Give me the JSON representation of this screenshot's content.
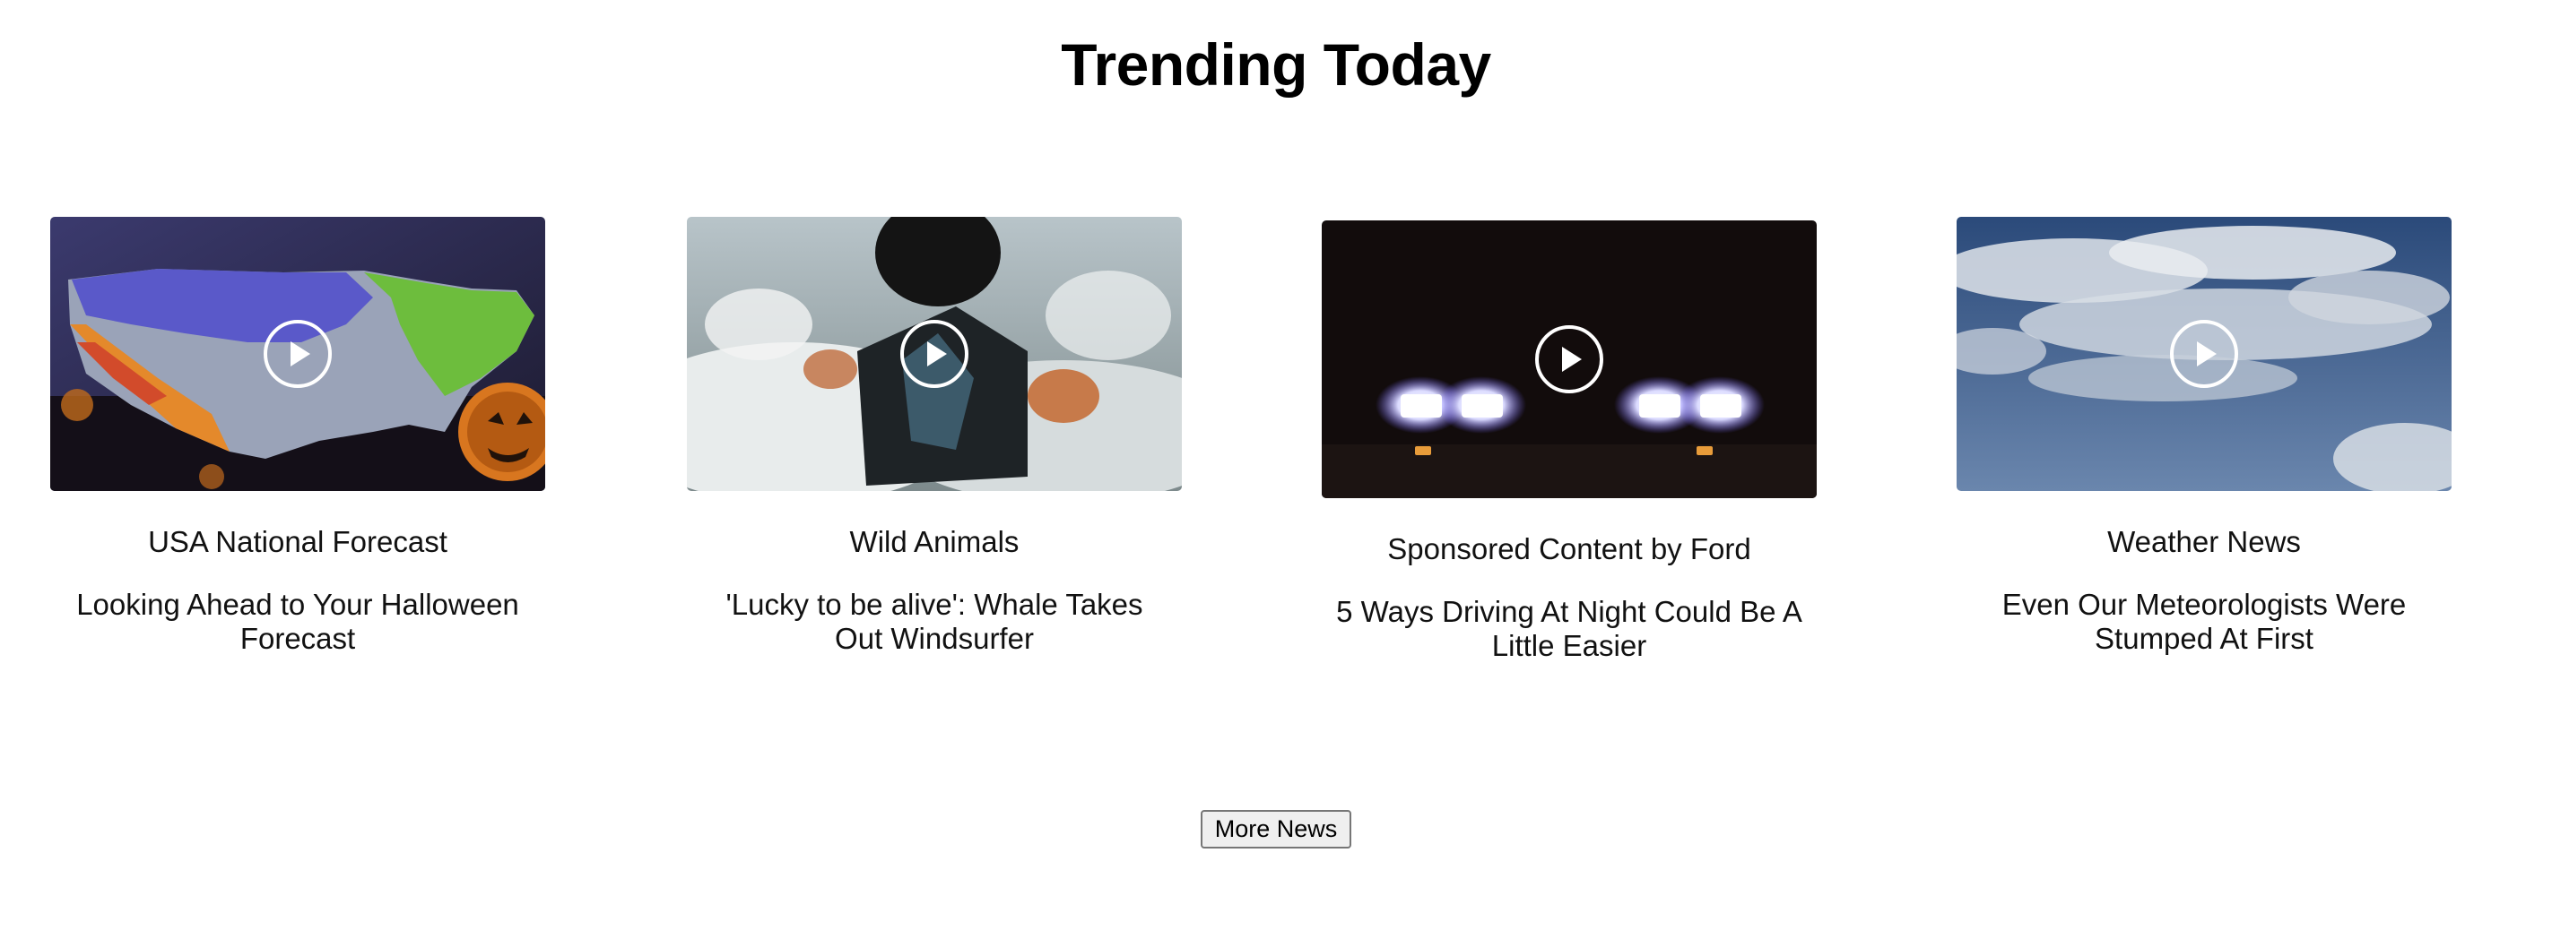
{
  "page": {
    "title": "Trending Today"
  },
  "cards": [
    {
      "category": "USA National Forecast",
      "headline": "Looking Ahead to Your Halloween Forecast",
      "thumbnail_icon": "play-icon"
    },
    {
      "category": "Wild Animals",
      "headline": "'Lucky to be alive': Whale Takes Out Windsurfer",
      "thumbnail_icon": "play-icon"
    },
    {
      "category": "Sponsored Content by Ford",
      "headline": "5 Ways Driving At Night Could Be A Little Easier",
      "thumbnail_icon": "play-icon"
    },
    {
      "category": "Weather News",
      "headline": "Even Our Meteorologists Were Stumped At First",
      "thumbnail_icon": "play-icon"
    }
  ],
  "footer": {
    "more_label": "More News"
  },
  "colors": {
    "background": "#ffffff",
    "text": "#111111",
    "button_bg": "#efefef",
    "button_border": "#767676"
  }
}
